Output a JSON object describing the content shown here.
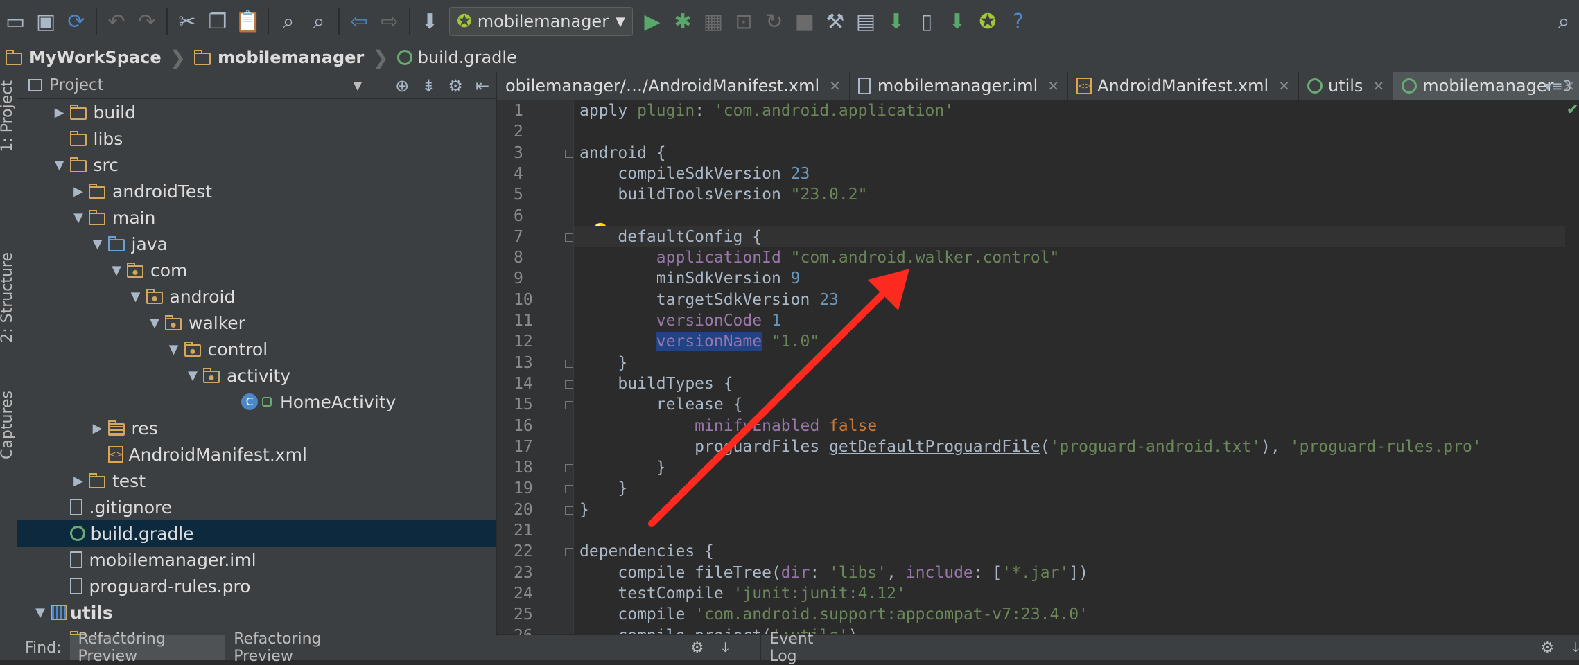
{
  "toolbar": {
    "run_config": "mobilemanager",
    "icons": [
      "folder-icon",
      "save-icon",
      "sync-icon",
      "undo-icon",
      "redo-icon",
      "cut-icon",
      "copy-icon",
      "paste-icon",
      "find-icon",
      "replace-icon",
      "back-icon",
      "forward-icon",
      "make-icon",
      "run-icon",
      "debug-icon",
      "coverage-icon",
      "attach-icon",
      "rerun-icon",
      "stop-icon",
      "sdk-manager-icon",
      "project-structure-icon",
      "avd-icon",
      "device-icon",
      "android-sdk-icon",
      "android-icon",
      "help-icon",
      "search-icon"
    ]
  },
  "breadcrumbs": [
    "MyWorkSpace",
    "mobilemanager",
    "build.gradle"
  ],
  "side_tabs": [
    "1: Project",
    "2: Structure",
    "Captures"
  ],
  "project_panel": {
    "title": "Project",
    "tree": [
      {
        "label": "build",
        "depth": 2,
        "arrow": "right",
        "icon": "folder"
      },
      {
        "label": "libs",
        "depth": 2,
        "arrow": "",
        "icon": "folder"
      },
      {
        "label": "src",
        "depth": 2,
        "arrow": "down",
        "icon": "folder"
      },
      {
        "label": "androidTest",
        "depth": 3,
        "arrow": "right",
        "icon": "folder"
      },
      {
        "label": "main",
        "depth": 3,
        "arrow": "down",
        "icon": "folder"
      },
      {
        "label": "java",
        "depth": 4,
        "arrow": "down",
        "icon": "folder-blue"
      },
      {
        "label": "com",
        "depth": 5,
        "arrow": "down",
        "icon": "package"
      },
      {
        "label": "android",
        "depth": 6,
        "arrow": "down",
        "icon": "package"
      },
      {
        "label": "walker",
        "depth": 7,
        "arrow": "down",
        "icon": "package"
      },
      {
        "label": "control",
        "depth": 8,
        "arrow": "down",
        "icon": "package"
      },
      {
        "label": "activity",
        "depth": 9,
        "arrow": "down",
        "icon": "package"
      },
      {
        "label": "HomeActivity",
        "depth": 11,
        "arrow": "",
        "icon": "class"
      },
      {
        "label": "res",
        "depth": 4,
        "arrow": "right",
        "icon": "res"
      },
      {
        "label": "AndroidManifest.xml",
        "depth": 4,
        "arrow": "",
        "icon": "xml"
      },
      {
        "label": "test",
        "depth": 3,
        "arrow": "right",
        "icon": "folder"
      },
      {
        "label": ".gitignore",
        "depth": 2,
        "arrow": "",
        "icon": "file"
      },
      {
        "label": "build.gradle",
        "depth": 2,
        "arrow": "",
        "icon": "gradle",
        "selected": true
      },
      {
        "label": "mobilemanager.iml",
        "depth": 2,
        "arrow": "",
        "icon": "file"
      },
      {
        "label": "proguard-rules.pro",
        "depth": 2,
        "arrow": "",
        "icon": "file"
      },
      {
        "label": "utils",
        "depth": 1,
        "arrow": "down",
        "icon": "module"
      },
      {
        "label": "build",
        "depth": 2,
        "arrow": "right",
        "icon": "folder"
      }
    ]
  },
  "editor_tabs": [
    {
      "label": "obilemanager/…/AndroidManifest.xml",
      "active": false
    },
    {
      "label": "mobilemanager.iml",
      "active": false
    },
    {
      "label": "AndroidManifest.xml",
      "active": false
    },
    {
      "label": "utils",
      "active": false
    },
    {
      "label": "mobilemanager",
      "active": true
    }
  ],
  "tab_overflow": "3",
  "code_lines": [
    [
      [
        "plain",
        "apply "
      ],
      [
        "str",
        "plugin"
      ],
      [
        "plain",
        ": "
      ],
      [
        "str",
        "'com.android.application'"
      ]
    ],
    [],
    [
      [
        "plain",
        "android {"
      ]
    ],
    [
      [
        "plain",
        "    compileSdkVersion "
      ],
      [
        "num",
        "23"
      ]
    ],
    [
      [
        "plain",
        "    buildToolsVersion "
      ],
      [
        "str",
        "\"23.0.2\""
      ]
    ],
    [],
    [
      [
        "plain",
        "    defaultConfig {"
      ]
    ],
    [
      [
        "prop",
        "        applicationId "
      ],
      [
        "str",
        "\"com.android.walker.control\""
      ]
    ],
    [
      [
        "plain",
        "        minSdkVersion "
      ],
      [
        "num",
        "9"
      ]
    ],
    [
      [
        "plain",
        "        targetSdkVersion "
      ],
      [
        "num",
        "23"
      ]
    ],
    [
      [
        "prop",
        "        versionCode "
      ],
      [
        "num",
        "1"
      ]
    ],
    [
      [
        "plain",
        "        "
      ],
      [
        "sel",
        "versionName"
      ],
      [
        "plain",
        " "
      ],
      [
        "str",
        "\"1.0\""
      ]
    ],
    [
      [
        "plain",
        "    }"
      ]
    ],
    [
      [
        "plain",
        "    buildTypes {"
      ]
    ],
    [
      [
        "plain",
        "        release {"
      ]
    ],
    [
      [
        "prop",
        "            minifyEnabled "
      ],
      [
        "kw",
        "false"
      ]
    ],
    [
      [
        "plain",
        "            proguardFiles "
      ],
      [
        "meth",
        "getDefaultProguardFile"
      ],
      [
        "plain",
        "("
      ],
      [
        "str",
        "'proguard-android.txt'"
      ],
      [
        "plain",
        "), "
      ],
      [
        "str",
        "'proguard-rules.pro'"
      ]
    ],
    [
      [
        "plain",
        "        }"
      ]
    ],
    [
      [
        "plain",
        "    }"
      ]
    ],
    [
      [
        "plain",
        "}"
      ]
    ],
    [],
    [
      [
        "plain",
        "dependencies {"
      ]
    ],
    [
      [
        "plain",
        "    compile fileTree("
      ],
      [
        "prop",
        "dir"
      ],
      [
        "plain",
        ": "
      ],
      [
        "str",
        "'libs'"
      ],
      [
        "plain",
        ", "
      ],
      [
        "prop",
        "include"
      ],
      [
        "plain",
        ": ["
      ],
      [
        "str",
        "'*.jar'"
      ],
      [
        "plain",
        "])"
      ]
    ],
    [
      [
        "plain",
        "    testCompile "
      ],
      [
        "str",
        "'junit:junit:4.12'"
      ]
    ],
    [
      [
        "plain",
        "    compile "
      ],
      [
        "str",
        "'com.android.support:appcompat-v7:23.4.0'"
      ]
    ],
    [
      [
        "plain",
        "    compile project("
      ],
      [
        "str",
        "':utils'"
      ],
      [
        "plain",
        ")"
      ]
    ]
  ],
  "bottom_bar": {
    "find_label": "Find:",
    "tabs": [
      "Refactoring Preview",
      "Refactoring Preview"
    ],
    "event_log": "Event Log"
  },
  "colors": {
    "annotation_arrow": "#ff2a1f",
    "selection": "#0d293e"
  }
}
